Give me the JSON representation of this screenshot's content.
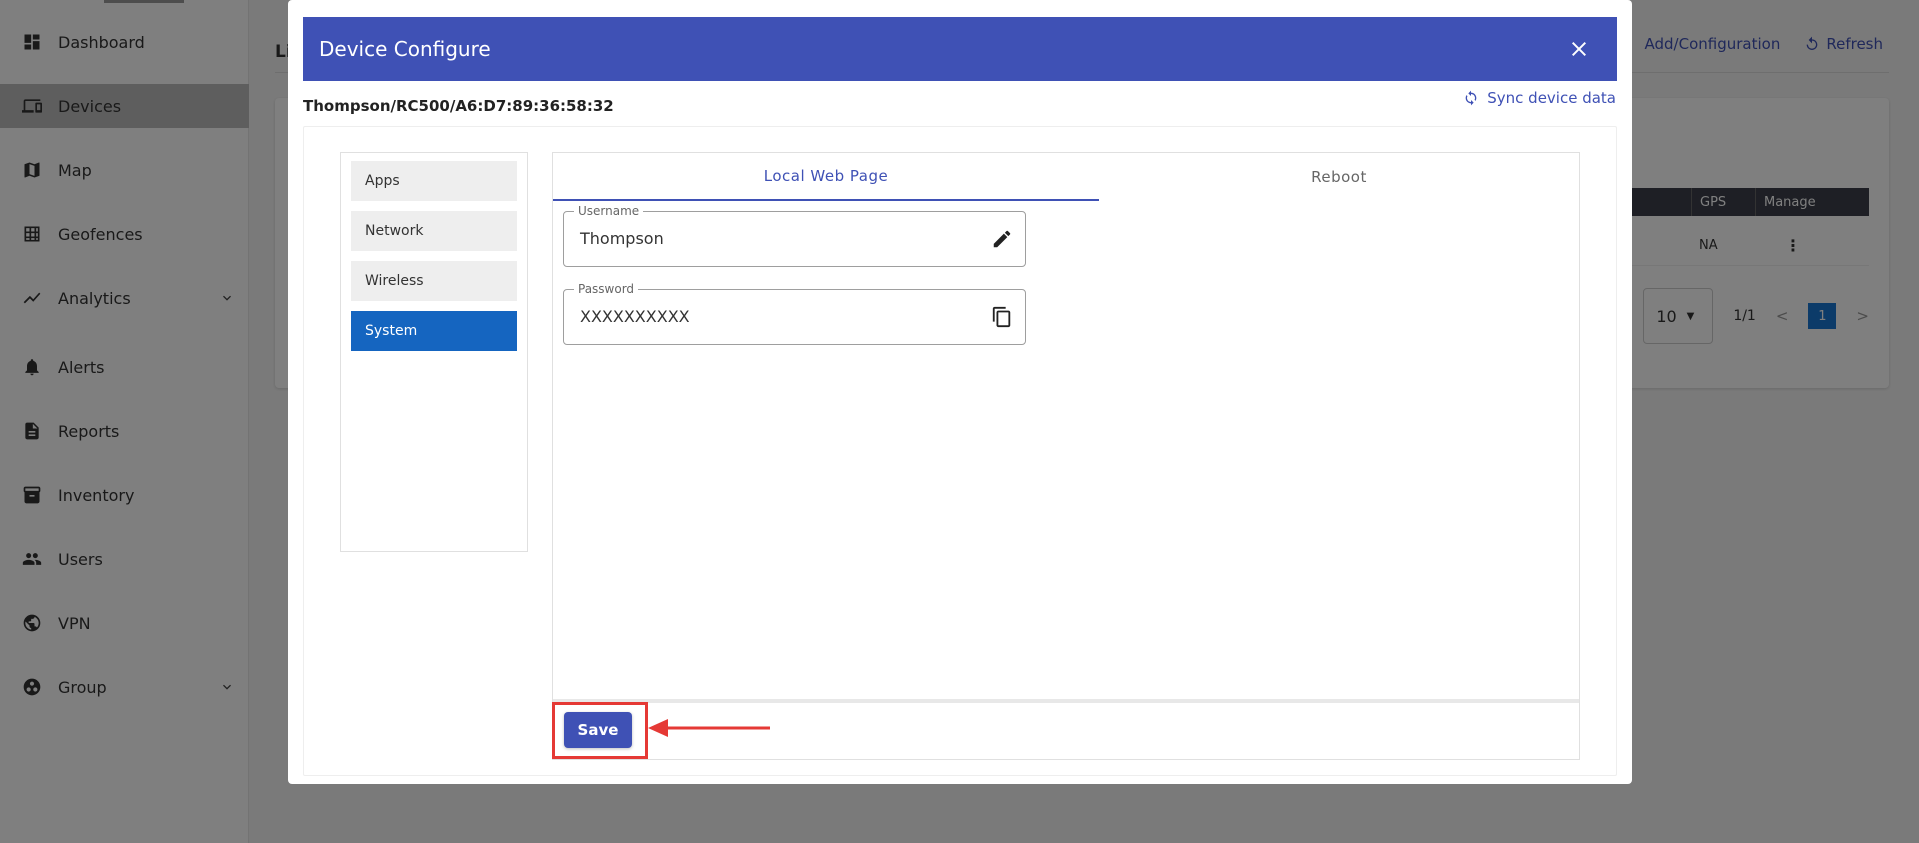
{
  "sidebar": {
    "items": [
      {
        "label": "Dashboard",
        "icon": "dashboard-icon"
      },
      {
        "label": "Devices",
        "icon": "devices-icon",
        "active": true
      },
      {
        "label": "Map",
        "icon": "map-icon"
      },
      {
        "label": "Geofences",
        "icon": "geofence-icon"
      },
      {
        "label": "Analytics",
        "icon": "analytics-icon",
        "expandable": true
      },
      {
        "label": "Alerts",
        "icon": "bell-icon"
      },
      {
        "label": "Reports",
        "icon": "reports-icon"
      },
      {
        "label": "Inventory",
        "icon": "inventory-icon"
      },
      {
        "label": "Users",
        "icon": "users-icon"
      },
      {
        "label": "VPN",
        "icon": "vpn-globe-icon"
      },
      {
        "label": "Group",
        "icon": "group-icon",
        "expandable": true
      }
    ]
  },
  "background": {
    "title_fragment": "Li",
    "actions": {
      "add_config": "Add/Configuration",
      "refresh": "Refresh"
    },
    "table": {
      "headers": [
        "GPS",
        "Manage"
      ],
      "row": {
        "gps": "NA"
      }
    },
    "pager": {
      "rows_per_page": "10",
      "page_info": "1/1",
      "current_page": "1",
      "prev": "<",
      "next": ">"
    }
  },
  "modal": {
    "title": "Device Configure",
    "device_path": "Thompson/RC500/A6:D7:89:36:58:32",
    "sync_label": "Sync device data",
    "menu": [
      "Apps",
      "Network",
      "Wireless",
      "System"
    ],
    "active_menu": "System",
    "tabs": [
      "Local Web Page",
      "Reboot"
    ],
    "active_tab": "Local Web Page",
    "fields": {
      "username": {
        "label": "Username",
        "value": "Thompson"
      },
      "password": {
        "label": "Password",
        "value": "XXXXXXXXXX"
      }
    },
    "save_label": "Save"
  },
  "colors": {
    "primary": "#3f51b5",
    "active_menu": "#1565c0",
    "highlight": "#e53935"
  }
}
